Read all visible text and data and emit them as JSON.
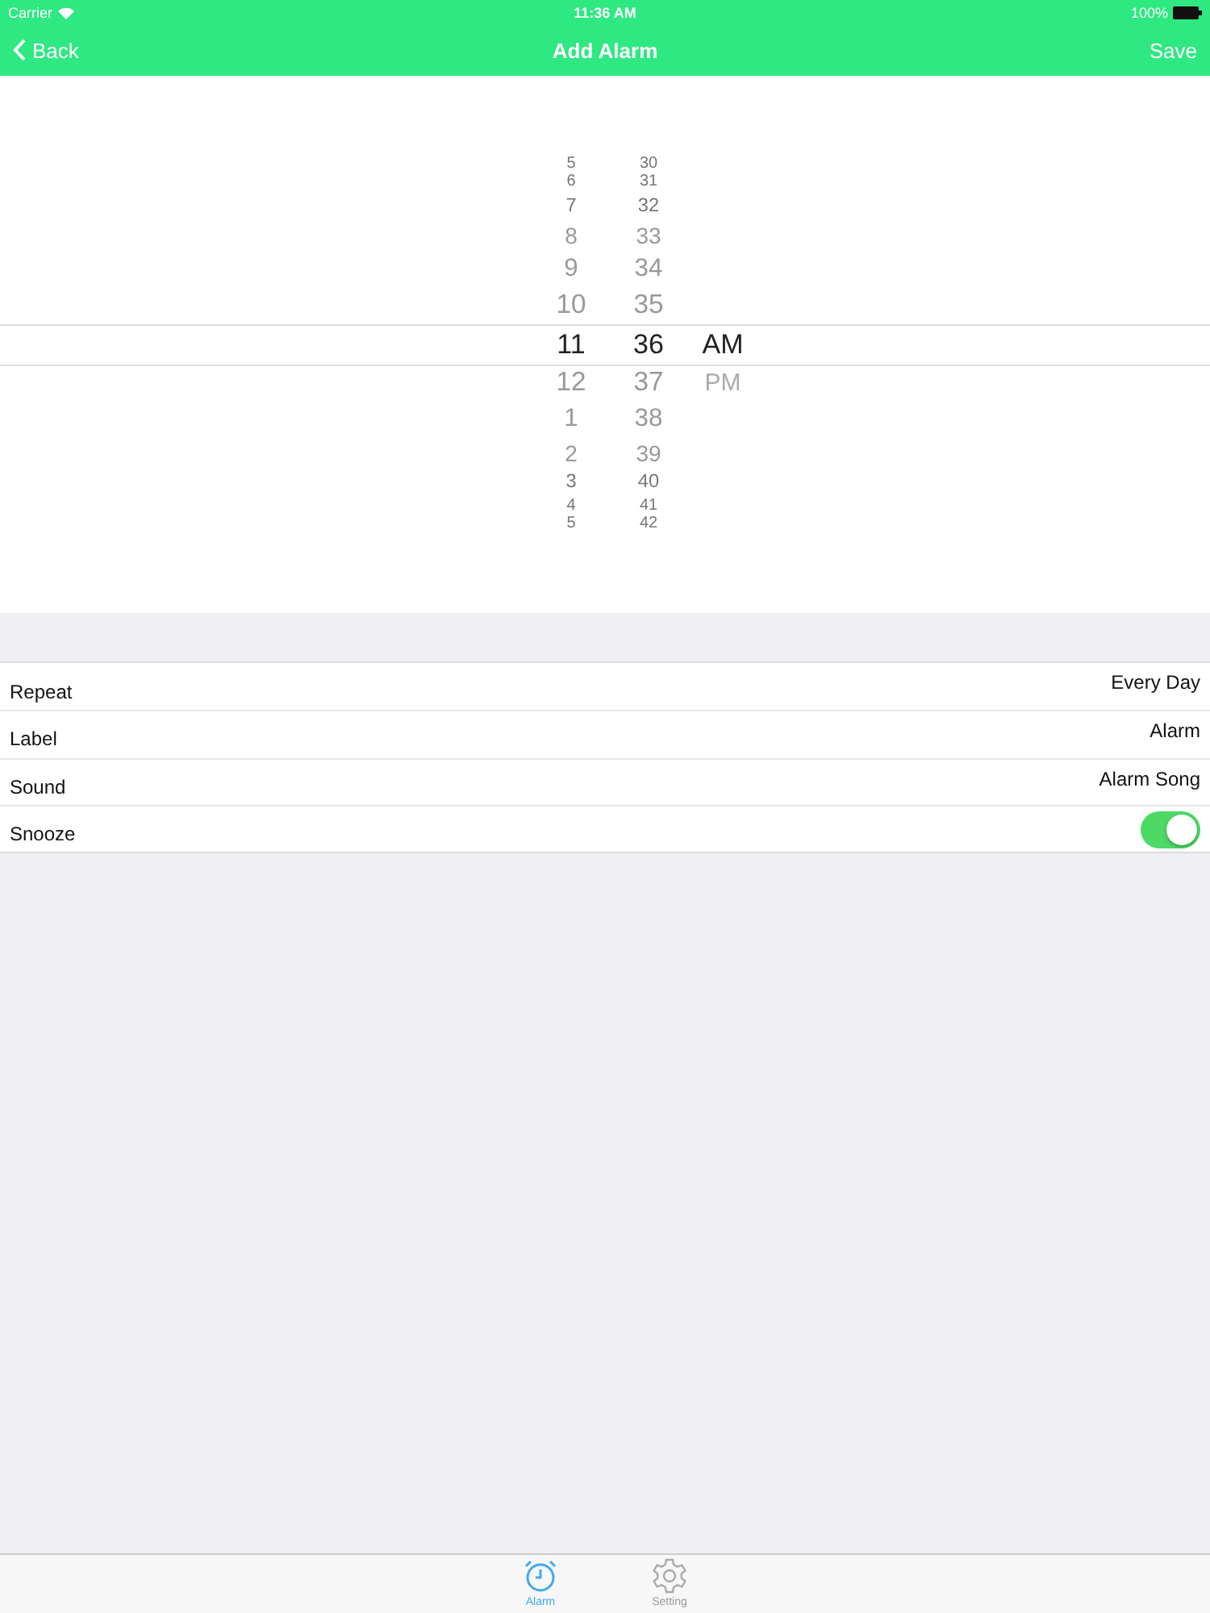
{
  "status_bar": {
    "carrier": "Carrier",
    "time": "11:36 AM",
    "battery": "100%"
  },
  "nav": {
    "back": "Back",
    "title": "Add Alarm",
    "action": "Save"
  },
  "picker": {
    "columns": [
      {
        "items": [
          {
            "text": "5",
            "selected": false
          },
          {
            "text": "6",
            "selected": false
          },
          {
            "text": "7",
            "selected": false
          },
          {
            "text": "8",
            "selected": false
          },
          {
            "text": "9",
            "selected": false
          },
          {
            "text": "10",
            "selected": false
          },
          {
            "text": "11",
            "selected": true
          },
          {
            "text": "12",
            "selected": false
          },
          {
            "text": "1",
            "selected": false
          },
          {
            "text": "2",
            "selected": false
          },
          {
            "text": "3",
            "selected": false
          },
          {
            "text": "4",
            "selected": false
          },
          {
            "text": "5",
            "selected": false
          }
        ]
      },
      {
        "items": [
          {
            "text": "30",
            "selected": false
          },
          {
            "text": "31",
            "selected": false
          },
          {
            "text": "32",
            "selected": false
          },
          {
            "text": "33",
            "selected": false
          },
          {
            "text": "34",
            "selected": false
          },
          {
            "text": "35",
            "selected": false
          },
          {
            "text": "36",
            "selected": true
          },
          {
            "text": "37",
            "selected": false
          },
          {
            "text": "38",
            "selected": false
          },
          {
            "text": "39",
            "selected": false
          },
          {
            "text": "40",
            "selected": false
          },
          {
            "text": "41",
            "selected": false
          },
          {
            "text": "42",
            "selected": false
          }
        ]
      },
      {
        "items": [
          {
            "text": "AM",
            "selected": true
          },
          {
            "text": "PM",
            "selected": false
          }
        ]
      }
    ]
  },
  "settings": [
    {
      "kind": "value",
      "label": "Repeat",
      "value": "Every Day"
    },
    {
      "kind": "value",
      "label": "Label",
      "value": "Alarm"
    },
    {
      "kind": "value",
      "label": "Sound",
      "value": "Alarm Song"
    },
    {
      "kind": "toggle",
      "label": "Snooze",
      "on": true
    }
  ],
  "tabs": [
    {
      "label": "Alarm",
      "selected": true
    },
    {
      "label": "Setting",
      "selected": false
    }
  ]
}
